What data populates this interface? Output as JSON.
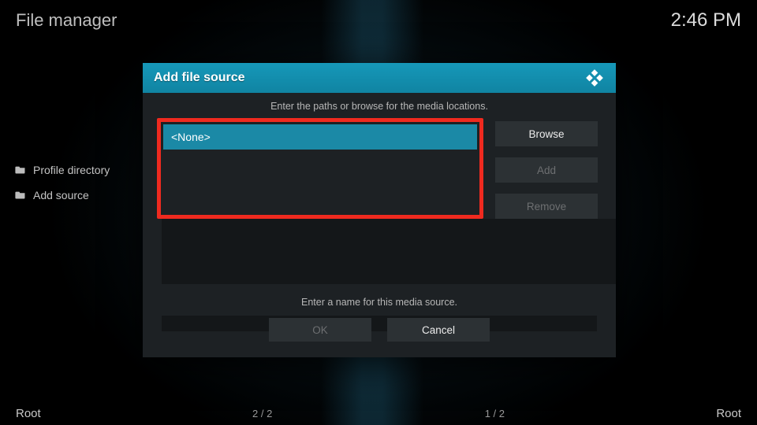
{
  "header": {
    "title": "File manager",
    "clock": "2:46 PM"
  },
  "sidebar": {
    "items": [
      {
        "label": "Profile directory"
      },
      {
        "label": "Add source"
      }
    ]
  },
  "footer": {
    "left": "Root",
    "pager_left": "2 / 2",
    "pager_right": "1 / 2",
    "right": "Root"
  },
  "dialog": {
    "title": "Add file source",
    "instruction_paths": "Enter the paths or browse for the media locations.",
    "path_value": "<None>",
    "browse_label": "Browse",
    "add_label": "Add",
    "remove_label": "Remove",
    "instruction_name": "Enter a name for this media source.",
    "name_value": "",
    "ok_label": "OK",
    "cancel_label": "Cancel"
  }
}
